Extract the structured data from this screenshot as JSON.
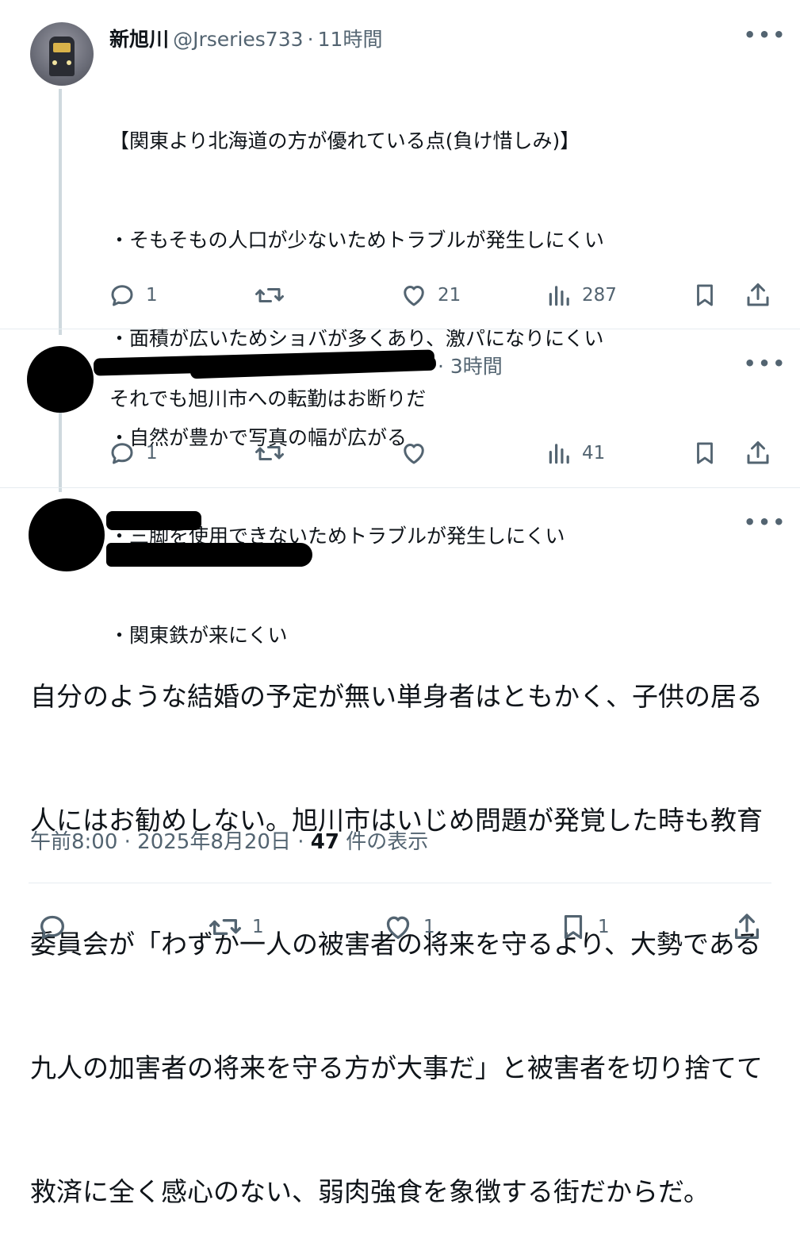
{
  "tweet1": {
    "display_name": "新旭川",
    "handle": "@Jrseries733",
    "separator": "·",
    "time": "11時間",
    "lines": [
      "【関東より北海道の方が優れている点(負け惜しみ)】",
      "・そもそもの人口が少ないためトラブルが発生しにくい",
      "・面積が広いためショバが多くあり、激パになりにくい",
      "・自然が豊かで写真の幅が広がる",
      "・三脚を使用できないためトラブルが発生しにくい",
      "・関東鉄が来にくい"
    ],
    "reply_count": "1",
    "like_count": "21",
    "view_count": "287"
  },
  "tweet2": {
    "time_suffix": "· 3時間",
    "text": "それでも旭川市への転勤はお断りだ",
    "reply_count": "1",
    "view_count": "41"
  },
  "main_tweet": {
    "lines": [
      "自分のような結婚の予定が無い単身者はともかく、子供の居る",
      "人にはお勧めしない。旭川市はいじめ問題が発覚した時も教育",
      "委員会が「わずか一人の被害者の将来を守るより、大勢である",
      "九人の加害者の将来を守る方が大事だ」と被害者を切り捨てて",
      "救済に全く感心のない、弱肉強食を象徴する街だからだ。"
    ],
    "timestamp": "午前8:00 · 2025年8月20日 · ",
    "views_number": "47",
    "views_label": " 件の表示",
    "retweet_count": "1",
    "like_count": "1",
    "bookmark_count": "1"
  },
  "icons": {
    "more": "more-icon",
    "reply": "reply-icon",
    "retweet": "retweet-icon",
    "like": "like-icon",
    "views": "views-icon",
    "bookmark": "bookmark-icon",
    "share": "share-icon"
  },
  "colors": {
    "text": "#0f1419",
    "secondary": "#536471",
    "divider": "#e6ecf0",
    "thread_line": "#cfd9de"
  }
}
